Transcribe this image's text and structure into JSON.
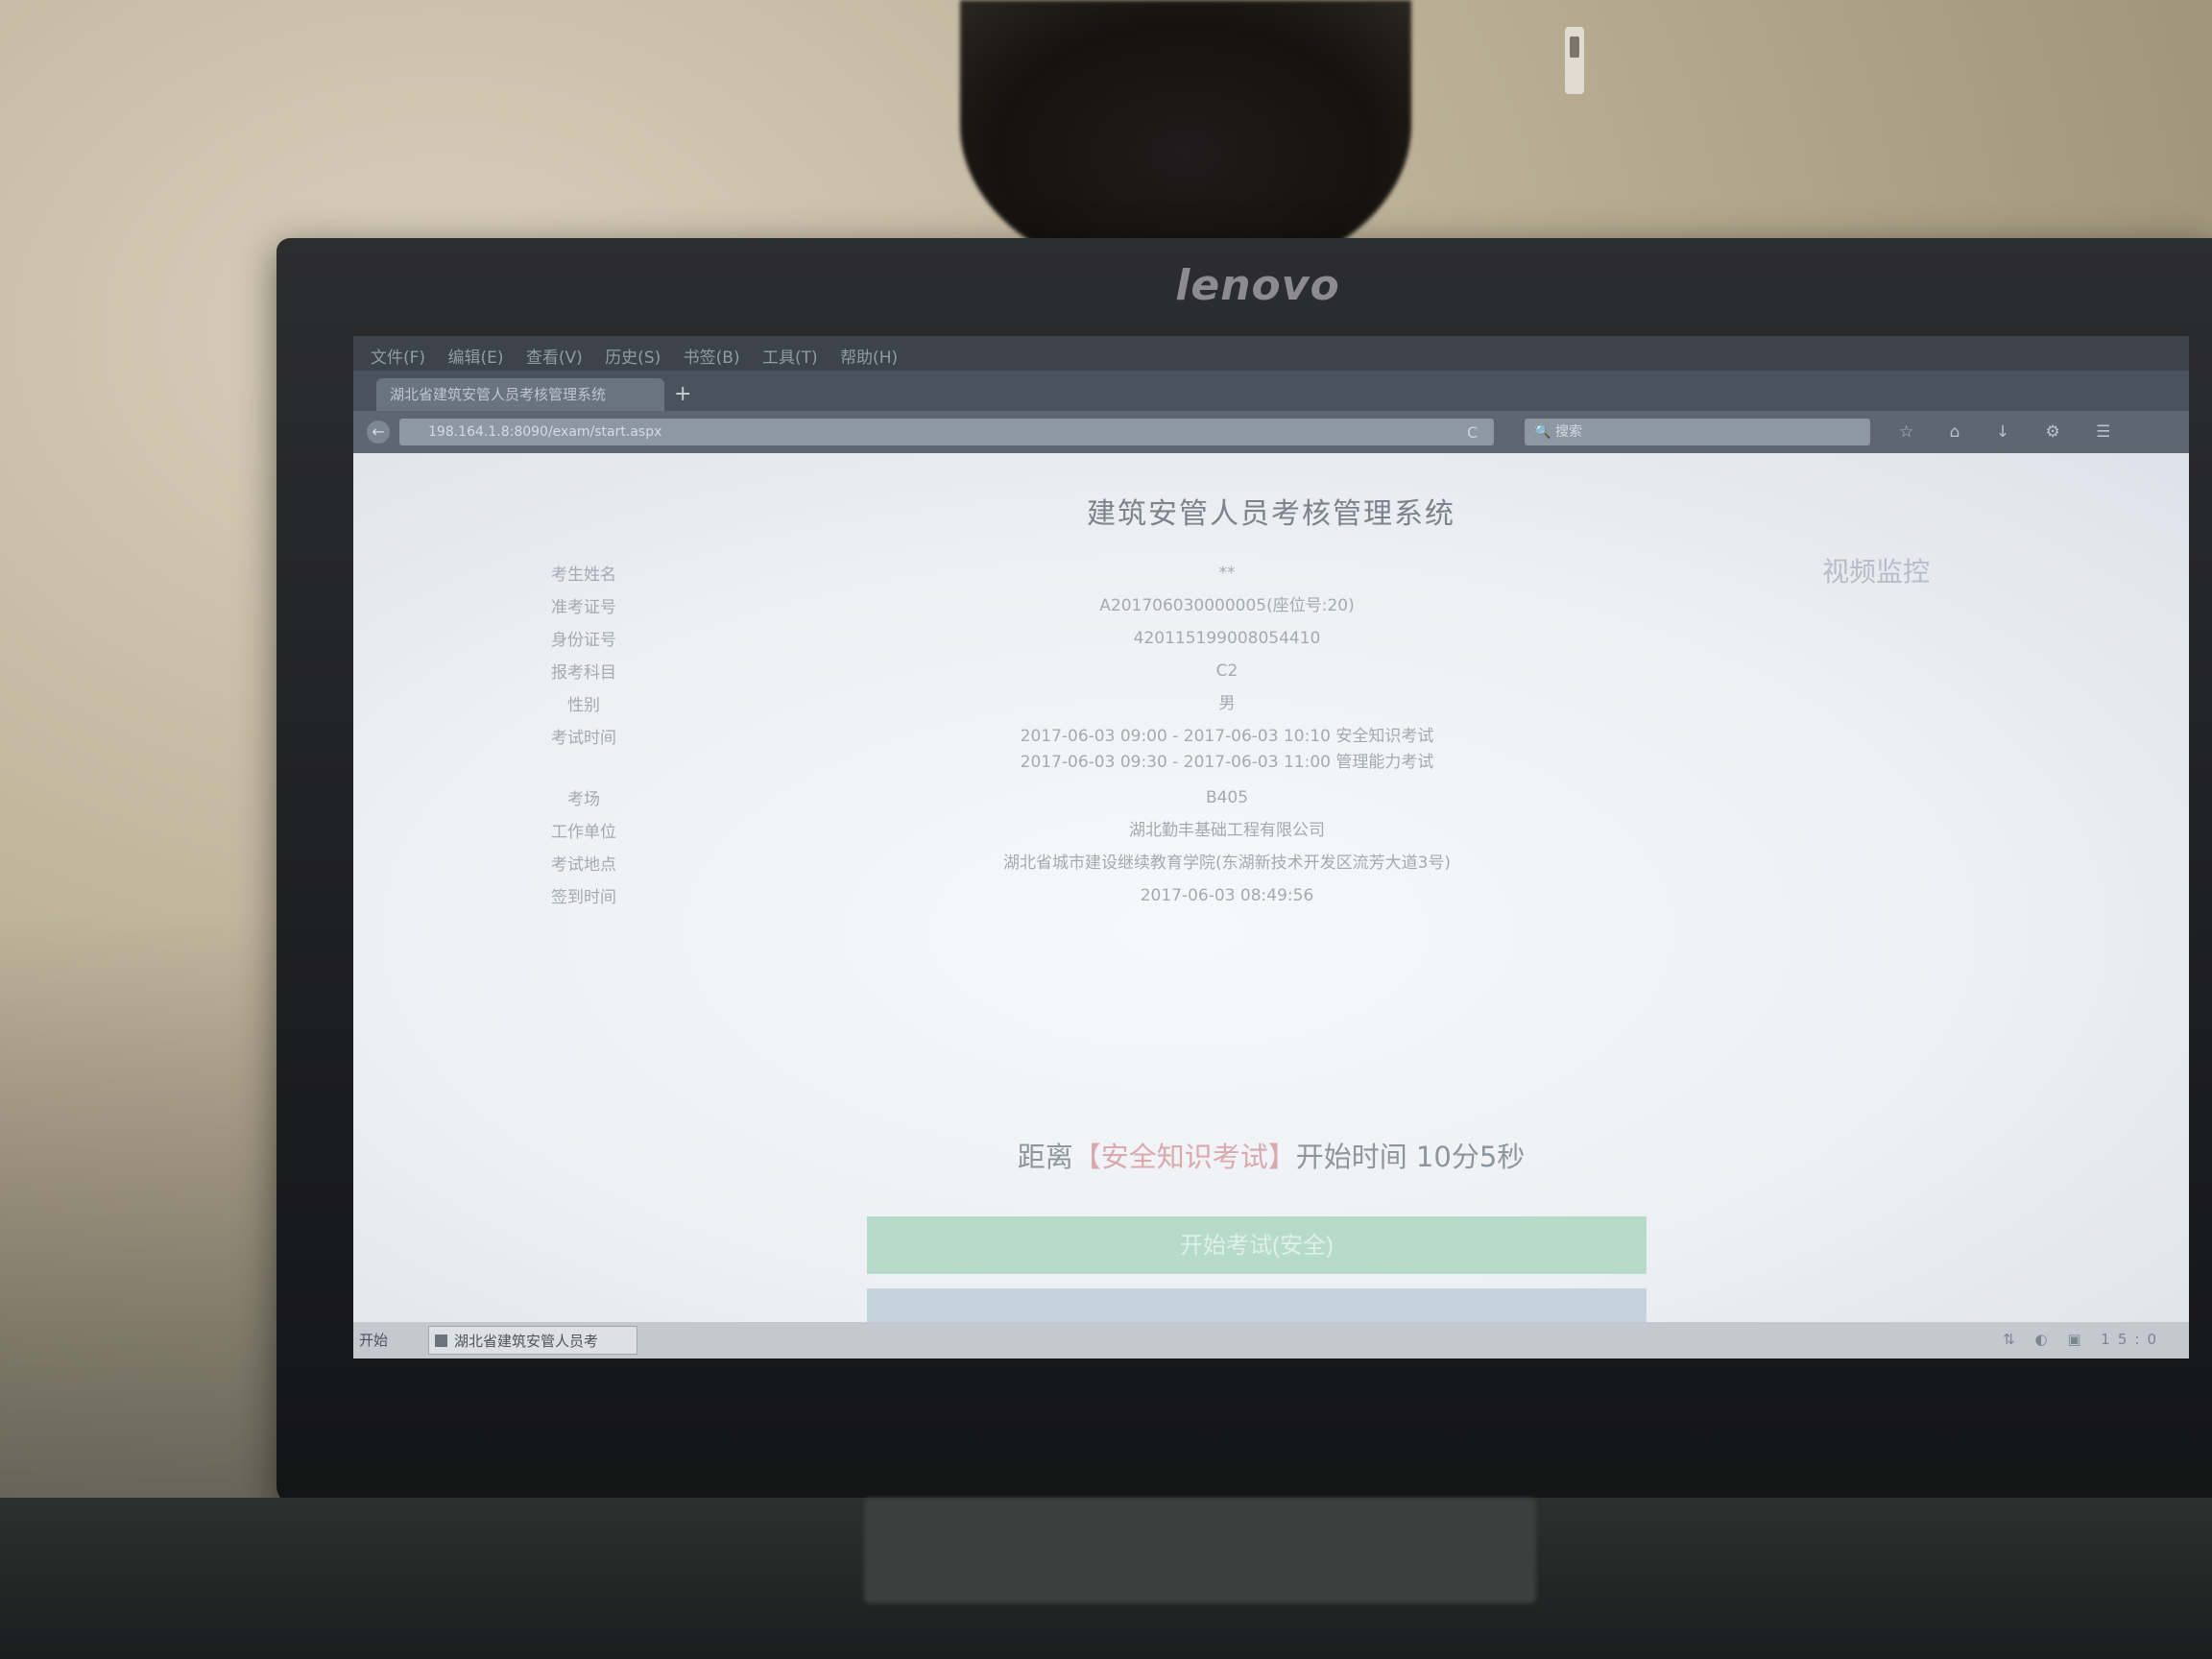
{
  "brand": "lenovo",
  "browser": {
    "menu": [
      "文件(F)",
      "编辑(E)",
      "查看(V)",
      "历史(S)",
      "书签(B)",
      "工具(T)",
      "帮助(H)"
    ],
    "tab_title": "湖北省建筑安管人员考核管理系统",
    "tab_add": "+",
    "back_symbol": "←",
    "address": "198.164.1.8:8090/exam/start.aspx",
    "reload_symbol": "C",
    "search_placeholder": "搜索",
    "search_symbol": "🔍",
    "nav_icons": "☆ ⌂ ↓ ⚙ ☰"
  },
  "page": {
    "title": "建筑安管人员考核管理系统",
    "video_link": "视频监控",
    "fields": [
      {
        "label": "考生姓名",
        "value": "**"
      },
      {
        "label": "准考证号",
        "value": "A201706030000005(座位号:20)"
      },
      {
        "label": "身份证号",
        "value": "420115199008054410"
      },
      {
        "label": "报考科目",
        "value": "C2"
      },
      {
        "label": "性别",
        "value": "男"
      },
      {
        "label": "考试时间",
        "value_lines": [
          "2017-06-03 09:00 - 2017-06-03 10:10 安全知识考试",
          "2017-06-03 09:30 - 2017-06-03 11:00 管理能力考试"
        ]
      },
      {
        "label": "考场",
        "value": "B405"
      },
      {
        "label": "工作单位",
        "value": "湖北勤丰基础工程有限公司"
      },
      {
        "label": "考试地点",
        "value": "湖北省城市建设继续教育学院(东湖新技术开发区流芳大道3号)"
      },
      {
        "label": "签到时间",
        "value": "2017-06-03 08:49:56"
      }
    ],
    "countdown": {
      "prefix": "距离",
      "highlight": "【安全知识考试】",
      "suffix": "开始时间 10分5秒"
    },
    "start_button": "开始考试(安全)"
  },
  "taskbar": {
    "start": "开始",
    "task": "湖北省建筑安管人员考",
    "tray": "⇅ ◐ ▣ 15:0"
  }
}
